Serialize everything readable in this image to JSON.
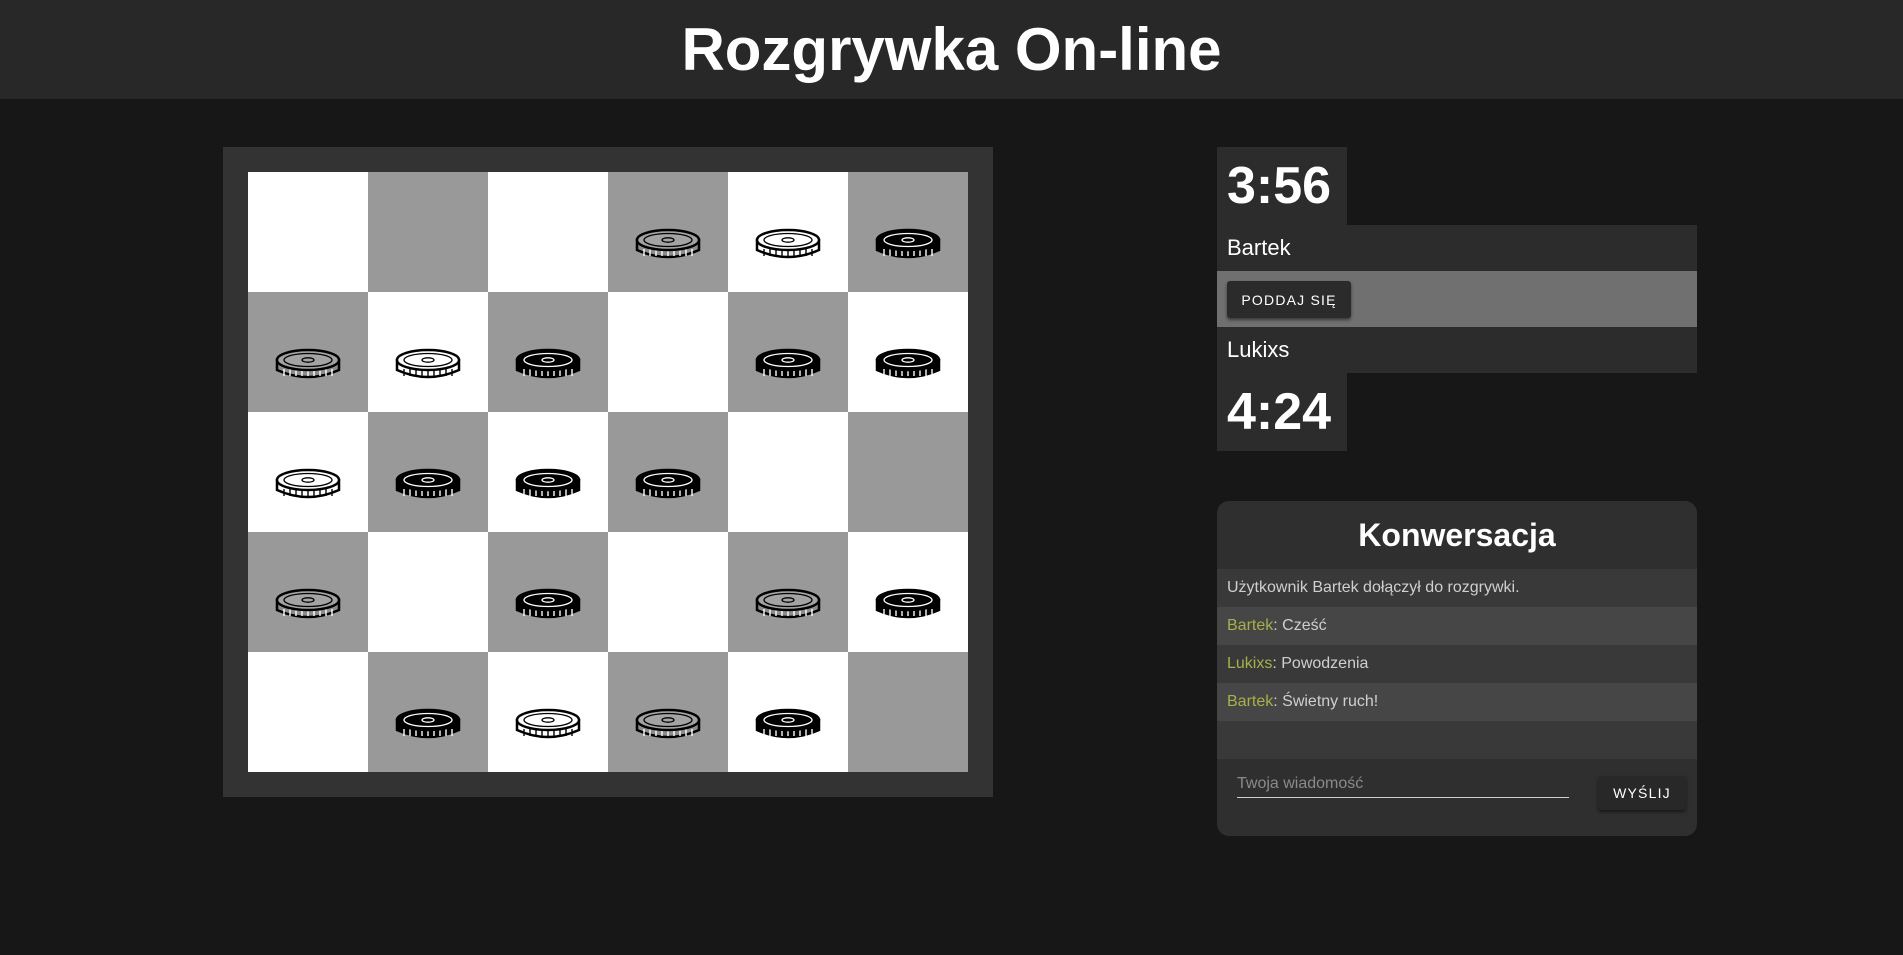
{
  "header": {
    "title": "Rozgrywka On-line"
  },
  "board": {
    "rows": 5,
    "cols": 6,
    "colors": {
      "light": "#ffffff",
      "dark": "#999999"
    },
    "cells": [
      [
        "empty",
        "empty",
        "empty",
        "grey",
        "white",
        "black"
      ],
      [
        "grey",
        "white",
        "black",
        "empty",
        "black",
        "black"
      ],
      [
        "white",
        "black",
        "black",
        "black",
        "empty",
        "empty"
      ],
      [
        "grey",
        "empty",
        "black",
        "empty",
        "grey",
        "black"
      ],
      [
        "empty",
        "black",
        "white",
        "grey",
        "black",
        "empty"
      ]
    ]
  },
  "players": {
    "top": {
      "name": "Bartek",
      "clock": "3:56"
    },
    "bottom": {
      "name": "Lukixs",
      "clock": "4:24"
    }
  },
  "resign": {
    "label": "PODDAJ SIĘ"
  },
  "chat": {
    "title": "Konwersacja",
    "messages": [
      {
        "author": "",
        "text": "Użytkownik Bartek dołączył do rozgrywki."
      },
      {
        "author": "Bartek",
        "text": ": Cześć"
      },
      {
        "author": "Lukixs",
        "text": ": Powodzenia"
      },
      {
        "author": "Bartek",
        "text": ": Świetny ruch!"
      },
      {
        "author": "",
        "text": ""
      }
    ],
    "input_placeholder": "Twoja wiadomość",
    "send_label": "WYŚLIJ",
    "author_color": "#a8b04a"
  }
}
